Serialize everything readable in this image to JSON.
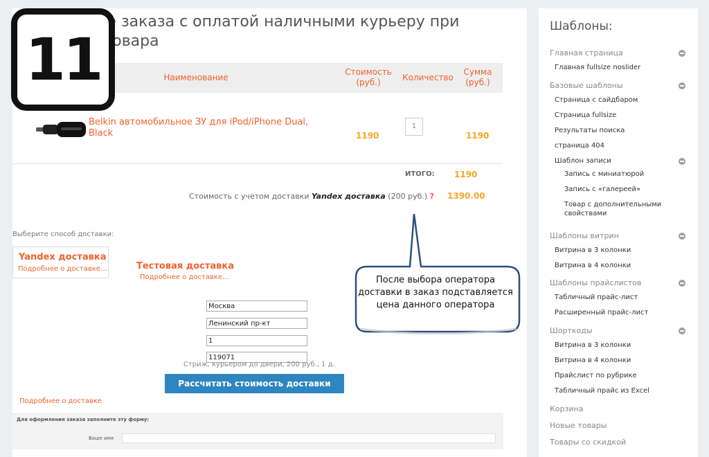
{
  "page": {
    "title": "Оформление заказа с оплатой наличными курьеру при получении товара",
    "step_number": "11"
  },
  "table": {
    "headers": {
      "name": "Наименование",
      "price": "Стоимость (руб.)",
      "qty": "Количество",
      "sum": "Сумма (руб.)"
    },
    "rows": [
      {
        "name": "Belkin автомобильное ЗУ для iPod/iPhone Dual, Black",
        "price": "1190",
        "qty": "1",
        "sum": "1190"
      }
    ],
    "total_label": "ИТОГО:",
    "total_value": "1190"
  },
  "delivery": {
    "cost_label": "Стоимость с учетом доставки",
    "operator": "Yandex доставка",
    "operator_price": "(200 руб.)",
    "question_mark": "?",
    "total_with_delivery": "1390.00",
    "choose_label": "Выберите способ доставки:",
    "options": [
      {
        "name": "Yandex доставка",
        "more": "Подробнее о доставке..."
      },
      {
        "name": "Тестовая доставка",
        "more": "Подробнее о доставке..."
      }
    ],
    "fields": [
      "Москва",
      "Ленинский пр-кт",
      "1",
      "119071"
    ],
    "calc_note": "Стриж, курьером до двери, 200 руб., 1 д.",
    "calc_button": "Рассчитать стоимость доставки",
    "more_link": "Подробнее о доставке"
  },
  "form": {
    "header": "Для оформления заказа заполните эту форму:",
    "field_label": "Ваше имя"
  },
  "callout": {
    "text": "После выбора оператора доставки в заказ подставляется цена данного оператора"
  },
  "sidebar": {
    "title": "Шаблоны:",
    "sections": {
      "main": "Главная страница",
      "base": "Базовые шаблоны",
      "showcase": "Шаблоны витрин",
      "pricelist": "Шаблоны прайслистов",
      "shortcodes": "Шорткоды",
      "cart": "Корзина",
      "new": "Новые товары",
      "discount": "Товары со скидкой"
    },
    "items": {
      "main_fullsize": "Главная fullsize noslider",
      "sidebar_page": "Страница с сайдбаром",
      "fullsize_page": "Страница fullsize",
      "search_results": "Результаты поиска",
      "page404": "страница 404",
      "post_template": "Шаблон записи",
      "post_thumb": "Запись с миниатюрой",
      "post_gallery": "Запись с «галереей»",
      "product_extra": "Товар с дополнительными свойствами",
      "showcase3": "Витрина в 3 колонки",
      "showcase4": "Витрина в 4 колонки",
      "table_price": "Табличный прайс-лист",
      "ext_price": "Расширенный прайс-лист",
      "sc_showcase3": "Витрина в 3 колонки",
      "sc_showcase4": "Витрина в 4 колонки",
      "sc_rubric": "Прайслист по рубрике",
      "sc_excel": "Табличный прайс из Excel"
    }
  }
}
